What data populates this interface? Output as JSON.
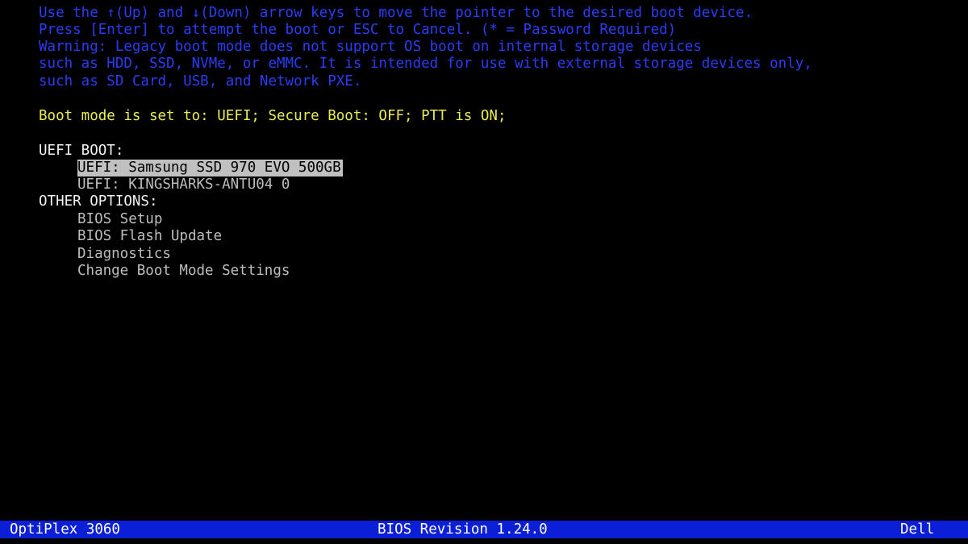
{
  "instructions": [
    "Use the ↑(Up) and ↓(Down) arrow keys to move the pointer to the desired boot device.",
    "Press [Enter] to attempt the boot or ESC to Cancel. (* = Password Required)",
    "Warning: Legacy boot mode does not support OS boot on internal storage devices",
    "such as HDD, SSD, NVMe, or eMMC. It is intended for use with external storage devices only,",
    "such as SD Card, USB, and Network PXE."
  ],
  "boot_mode_status": "Boot mode is set to: UEFI; Secure Boot: OFF; PTT is ON;",
  "uefi_boot": {
    "heading": "UEFI BOOT:",
    "items": [
      {
        "label": "UEFI: Samsung SSD 970 EVO 500GB",
        "selected": true
      },
      {
        "label": "UEFI: KINGSHARKS-ANTU04 0",
        "selected": false
      }
    ]
  },
  "other_options": {
    "heading": "OTHER OPTIONS:",
    "items": [
      {
        "label": "BIOS Setup"
      },
      {
        "label": "BIOS Flash Update"
      },
      {
        "label": "Diagnostics"
      },
      {
        "label": "Change Boot Mode Settings"
      }
    ]
  },
  "status_bar": {
    "model": "OptiPlex 3060",
    "bios_revision": "BIOS Revision 1.24.0",
    "vendor": "Dell"
  },
  "colors": {
    "background": "#000000",
    "instruction_text": "#2b3cf5",
    "status_text": "#ecec52",
    "heading_text": "#f2f2f2",
    "item_text": "#bdbdbd",
    "selection_highlight": "#c0c0c0",
    "status_bar": "#0b1fd6"
  }
}
